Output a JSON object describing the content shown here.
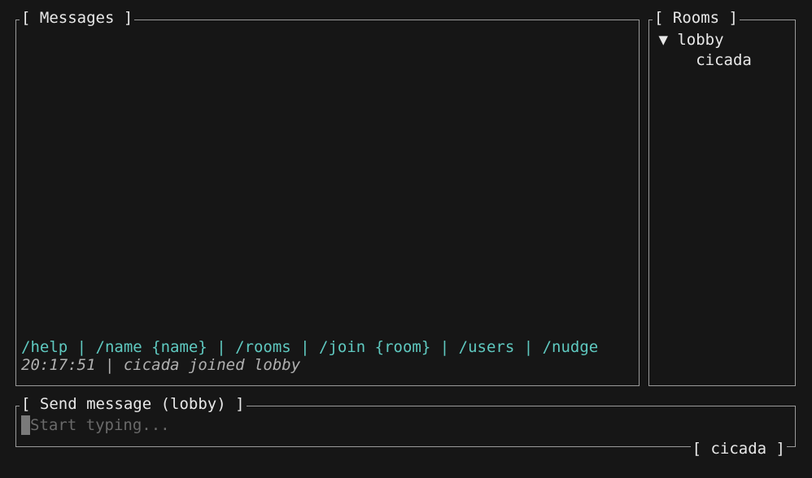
{
  "messages": {
    "title": "[ Messages ]",
    "help_line": "/help | /name {name} | /rooms | /join {room} | /users | /nudge",
    "event_time": "20:17:51",
    "event_sep": " | ",
    "event_text": "cicada joined lobby"
  },
  "rooms": {
    "title": "[ Rooms ]",
    "items": [
      {
        "expanded": true,
        "name": "lobby",
        "users": [
          "cicada"
        ]
      }
    ]
  },
  "input": {
    "title": "[ Send message (lobby) ]",
    "placeholder": "Start typing...",
    "username_tag": "[ cicada ]"
  }
}
